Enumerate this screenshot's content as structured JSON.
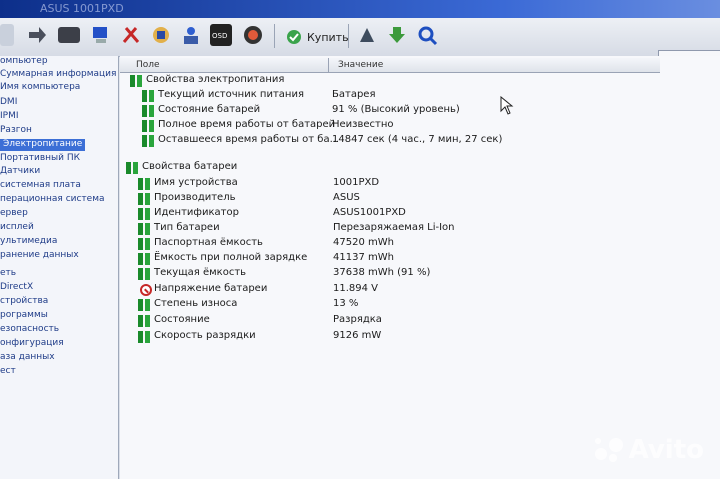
{
  "window": {
    "title": "ASUS 1001PXD"
  },
  "toolbar": {
    "buy_label": "Купить"
  },
  "columns": {
    "field": "Поле",
    "value": "Значение"
  },
  "sidebar": {
    "items": [
      {
        "label": "омпьютер"
      },
      {
        "label": "Суммарная информация"
      },
      {
        "label": "Имя компьютера"
      },
      {
        "label": "DMI"
      },
      {
        "label": "IPMI"
      },
      {
        "label": "Разгон"
      },
      {
        "label": "Электропитание",
        "selected": true
      },
      {
        "label": "Портативный ПК"
      },
      {
        "label": "Датчики"
      },
      {
        "label": "системная плата"
      },
      {
        "label": "перационная система"
      },
      {
        "label": "ервер"
      },
      {
        "label": "исплей"
      },
      {
        "label": "ультимедиа"
      },
      {
        "label": "ранение данных"
      },
      {
        "label": "еть"
      },
      {
        "label": "DirectX"
      },
      {
        "label": "стройства"
      },
      {
        "label": "рограммы"
      },
      {
        "label": "езопасность"
      },
      {
        "label": "онфигурация"
      },
      {
        "label": "аза данных"
      },
      {
        "label": "ест"
      }
    ]
  },
  "sections": [
    {
      "title": "Свойства электропитания",
      "rows": [
        {
          "label": "Текущий источник питания",
          "value": "Батарея"
        },
        {
          "label": "Состояние батарей",
          "value": "91 % (Высокий уровень)"
        },
        {
          "label": "Полное время работы от батарей",
          "value": "Неизвестно"
        },
        {
          "label": "Оставшееся время работы от ба...",
          "value": "14847 сек (4 час., 7 мин, 27 сек)"
        }
      ]
    },
    {
      "title": "Свойства батареи",
      "rows": [
        {
          "label": "Имя устройства",
          "value": "1001PXD"
        },
        {
          "label": "Производитель",
          "value": "ASUS"
        },
        {
          "label": "Идентификатор",
          "value": "ASUS1001PXD"
        },
        {
          "label": "Тип батареи",
          "value": "Перезаряжаемая Li-Ion"
        },
        {
          "label": "Паспортная ёмкость",
          "value": "47520 mWh"
        },
        {
          "label": "Ёмкость при полной зарядке",
          "value": "41137 mWh"
        },
        {
          "label": "Текущая ёмкость",
          "value": "37638 mWh  (91 %)"
        },
        {
          "label": "Напряжение батареи",
          "value": "11.894 V",
          "icon": "voltage-icon"
        },
        {
          "label": "Степень износа",
          "value": "13 %"
        },
        {
          "label": "Состояние",
          "value": "Разрядка"
        },
        {
          "label": "Скорость разрядки",
          "value": "9126 mW"
        }
      ]
    }
  ],
  "watermark": {
    "text": "Avito"
  }
}
